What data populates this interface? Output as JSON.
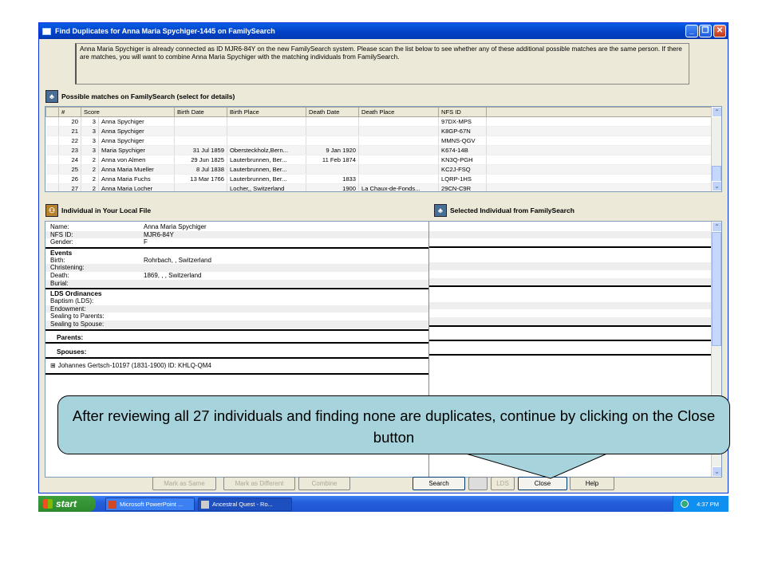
{
  "window": {
    "title": "Find Duplicates for Anna Maria Spychiger-1445 on FamilySearch"
  },
  "info": "Anna Maria Spychiger is already connected as ID MJR6-84Y on the new FamilySearch system. Please scan the list below to see whether any of these additional possible matches are the same person. If there are matches, you will want to combine Anna Maria Spychiger with the matching individuals from FamilySearch.",
  "matches": {
    "title": "Possible matches on FamilySearch (select for details)",
    "columns": [
      "#",
      "Score",
      "Name",
      "Birth Date",
      "Birth Place",
      "Death Date",
      "Death Place",
      "NFS ID"
    ],
    "rows": [
      [
        "20",
        "3",
        "Anna Spychiger",
        "",
        "",
        "",
        "",
        "97DX-MPS"
      ],
      [
        "21",
        "3",
        "Anna Spychiger",
        "",
        "",
        "",
        "",
        "K8GP-67N"
      ],
      [
        "22",
        "3",
        "Anna Spychiger",
        "",
        "",
        "",
        "",
        "MMNS-QGV"
      ],
      [
        "23",
        "3",
        "Maria Spychiger",
        "31 Jul 1859",
        "Obersteckholz,Bern...",
        "9 Jan 1920",
        "",
        "K674-14B"
      ],
      [
        "24",
        "2",
        "Anna von Almen",
        "29 Jun 1825",
        "Lauterbrunnen, Ber...",
        "11 Feb 1874",
        "",
        "KN3Q-PGH"
      ],
      [
        "25",
        "2",
        "Anna Maria Mueller",
        "8 Jul 1838",
        "Lauterbrunnen, Ber...",
        "",
        "",
        "KC2J-FSQ"
      ],
      [
        "26",
        "2",
        "Anna Maria Fuchs",
        "13 Mar 1766",
        "Lauterbrunnen, Ber...",
        "1833",
        "",
        "LQRP-1HS"
      ],
      [
        "27",
        "2",
        "Anna Maria Locher",
        "",
        "Locher,, Switzerland",
        "1900",
        "La Chaux-de-Fonds...",
        "29CN-C9R"
      ]
    ]
  },
  "local": {
    "title": "Individual in Your Local File"
  },
  "selected": {
    "title": "Selected Individual from FamilySearch"
  },
  "details": {
    "name_label": "Name:",
    "name": "Anna Maria Spychiger",
    "nfs_label": "NFS ID:",
    "nfs": "MJR6-84Y",
    "gender_label": "Gender:",
    "gender": "F",
    "events": "Events",
    "birth_label": "Birth:",
    "birth": "Rohrbach, , Switzerland",
    "christening_label": "Christening:",
    "death_label": "Death:",
    "death": "1869, , , Switzerland",
    "burial_label": "Burial:",
    "lds": "LDS Ordinances",
    "baptism_label": "Baptism (LDS):",
    "endowment_label": "Endowment:",
    "sealing_parents_label": "Sealing to Parents:",
    "sealing_spouse_label": "Sealing to Spouse:",
    "parents": "Parents:",
    "spouses": "Spouses:",
    "spouse_expander": "⊞",
    "spouse1": "Johannes Gertsch-10197 (1831-1900)  ID: KHLQ-QM4"
  },
  "buttons": {
    "mark_same": "Mark as Same",
    "mark_different": "Mark as Different",
    "combine": "Combine",
    "search": "Search",
    "lds": "LDS",
    "close": "Close",
    "help": "Help"
  },
  "callout": "After reviewing all 27 individuals and finding none are duplicates, continue by clicking on the Close button",
  "taskbar": {
    "start": "start",
    "tasks": [
      "Microsoft PowerPoint ...",
      "Ancestral Quest - Ro..."
    ],
    "clock": "4:37 PM"
  },
  "icons": {
    "app": "window-icon",
    "tree": "tree-icon",
    "family": "family-icon",
    "lds": "temple-icon",
    "ppt": "powerpoint-icon",
    "aq": "ancestral-quest-icon",
    "tray": "network-icon"
  },
  "glyphs": {
    "minimize": "_",
    "maximize": "❐",
    "close": "✕",
    "scroll_up": "⌃",
    "scroll_down": "⌄",
    "tree": "♣",
    "family": "⚇"
  }
}
